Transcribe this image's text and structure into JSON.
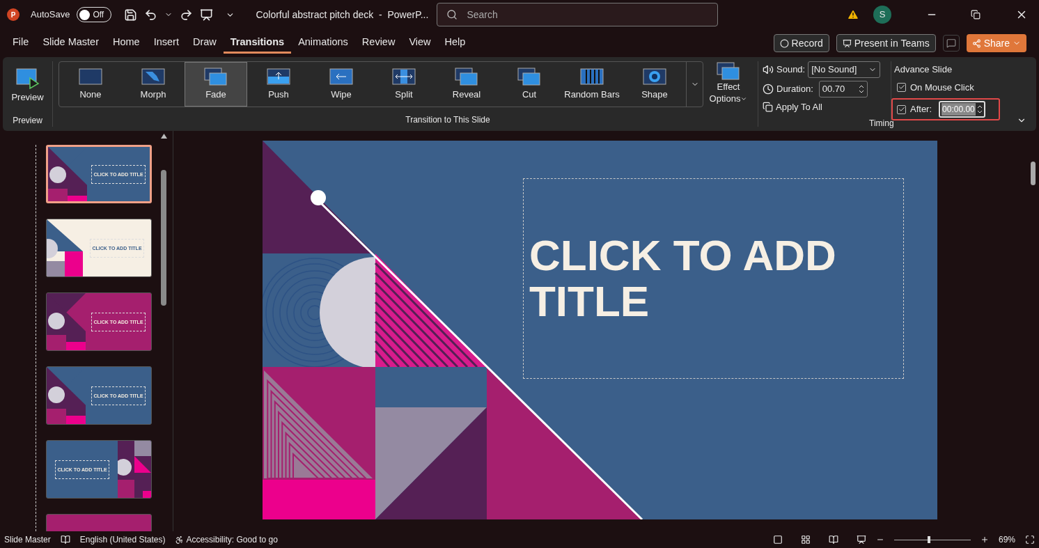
{
  "titlebar": {
    "app_letter": "P",
    "autosave_label": "AutoSave",
    "autosave": {
      "on": false,
      "label": "Off"
    },
    "document_title": "Colorful abstract pitch deck  -  PowerP...",
    "search_placeholder": "Search",
    "avatar": "S"
  },
  "menu_tabs": [
    {
      "label": "File",
      "selected": false
    },
    {
      "label": "Slide Master",
      "selected": false
    },
    {
      "label": "Home",
      "selected": false
    },
    {
      "label": "Insert",
      "selected": false
    },
    {
      "label": "Draw",
      "selected": false
    },
    {
      "label": "Transitions",
      "selected": true
    },
    {
      "label": "Animations",
      "selected": false
    },
    {
      "label": "Review",
      "selected": false
    },
    {
      "label": "View",
      "selected": false
    },
    {
      "label": "Help",
      "selected": false
    }
  ],
  "actions": {
    "record": "Record",
    "present": "Present in Teams",
    "share": "Share"
  },
  "ribbon": {
    "preview": {
      "button": "Preview",
      "group": "Preview"
    },
    "transitions": [
      {
        "label": "None",
        "selected": false,
        "kind": "none"
      },
      {
        "label": "Morph",
        "selected": false,
        "kind": "morph"
      },
      {
        "label": "Fade",
        "selected": true,
        "kind": "fade"
      },
      {
        "label": "Push",
        "selected": false,
        "kind": "push"
      },
      {
        "label": "Wipe",
        "selected": false,
        "kind": "wipe"
      },
      {
        "label": "Split",
        "selected": false,
        "kind": "split"
      },
      {
        "label": "Reveal",
        "selected": false,
        "kind": "fade"
      },
      {
        "label": "Cut",
        "selected": false,
        "kind": "fade"
      },
      {
        "label": "Random Bars",
        "selected": false,
        "kind": "bars"
      },
      {
        "label": "Shape",
        "selected": false,
        "kind": "shape"
      }
    ],
    "effect_options": [
      "Effect",
      "Options"
    ],
    "transitions_group": "Transition to This Slide",
    "sound_label": "Sound:",
    "sound_value": "[No Sound]",
    "duration_label": "Duration:",
    "duration_value": "00.70",
    "apply_all": "Apply To All",
    "advance_title": "Advance Slide",
    "on_mouse_click": {
      "label": "On Mouse Click",
      "checked": true
    },
    "after": {
      "label": "After:",
      "checked": true,
      "value": "00:00.00"
    },
    "timing_group": "Timing"
  },
  "thumbnails": [
    {
      "title": "CLICK TO ADD TITLE",
      "selected": true,
      "color": "#3b5f8a"
    },
    {
      "title": "CLICK TO ADD TITLE",
      "selected": false,
      "color": "#f6efe4"
    },
    {
      "title": "CLICK TO ADD TITLE",
      "selected": false,
      "color": "#a51f6e"
    },
    {
      "title": "CLICK TO ADD TITLE",
      "selected": false,
      "color": "#3b5f8a"
    },
    {
      "title": "CLICK TO ADD TITLE",
      "selected": false,
      "color": "#3b5f8a"
    },
    {
      "selected": false,
      "color": "#a51f6e"
    }
  ],
  "slide": {
    "title": "CLICK TO ADD TITLE"
  },
  "status": {
    "view": "Slide Master",
    "language": "English (United States)",
    "accessibility": "Accessibility: Good to go",
    "zoom": "69%",
    "zoom_slider": {
      "level": 0.45
    }
  }
}
